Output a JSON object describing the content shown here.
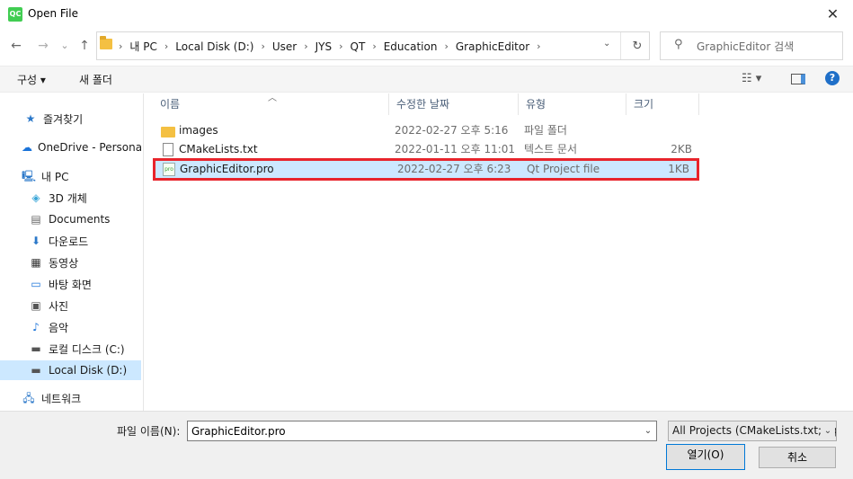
{
  "window": {
    "title": "Open File",
    "app_icon_text": "QC"
  },
  "nav": {
    "back": "←",
    "forward": "→",
    "recent": "⌄",
    "up": "↑",
    "breadcrumbs": [
      "내 PC",
      "Local Disk (D:)",
      "User",
      "JYS",
      "QT",
      "Education",
      "GraphicEditor"
    ],
    "search_placeholder": "GraphicEditor 검색"
  },
  "toolbar": {
    "organize": "구성 ▾",
    "new_folder": "새 폴더"
  },
  "sidebar": {
    "items": [
      {
        "label": "즐겨찾기",
        "icon": "star-icon"
      },
      {
        "label": "OneDrive - Personal",
        "icon": "cloud-icon"
      },
      {
        "label": "내 PC",
        "icon": "pc-icon"
      },
      {
        "label": "3D 개체",
        "icon": "cube-icon"
      },
      {
        "label": "Documents",
        "icon": "document-icon"
      },
      {
        "label": "다운로드",
        "icon": "download-icon"
      },
      {
        "label": "동영상",
        "icon": "video-icon"
      },
      {
        "label": "바탕 화면",
        "icon": "desktop-icon"
      },
      {
        "label": "사진",
        "icon": "picture-icon"
      },
      {
        "label": "음악",
        "icon": "music-icon"
      },
      {
        "label": "로컬 디스크 (C:)",
        "icon": "drive-icon"
      },
      {
        "label": "Local Disk (D:)",
        "icon": "drive-icon"
      },
      {
        "label": "네트워크",
        "icon": "network-icon"
      }
    ],
    "selected_label": "Local Disk (D:)"
  },
  "columns": {
    "name": "이름",
    "date": "수정한 날짜",
    "type": "유형",
    "size": "크기"
  },
  "files": [
    {
      "name": "images",
      "date": "2022-02-27 오후 5:16",
      "type": "파일 폴더",
      "size": "",
      "icon": "folder-icon"
    },
    {
      "name": "CMakeLists.txt",
      "date": "2022-01-11 오후 11:01",
      "type": "텍스트 문서",
      "size": "2KB",
      "icon": "text-file-icon"
    },
    {
      "name": "GraphicEditor.pro",
      "date": "2022-02-27 오후 6:23",
      "type": "Qt Project file",
      "size": "1KB",
      "icon": "pro-file-icon",
      "icon_text": "pro"
    }
  ],
  "bottom": {
    "filename_label": "파일 이름(N):",
    "filename_value": "GraphicEditor.pro",
    "filter_value": "All Projects (CMakeLists.txt;*.q",
    "open_label": "열기(O)",
    "cancel_label": "취소"
  },
  "colors": {
    "selection": "#cce8ff",
    "highlight": "#e8242c",
    "qt_green": "#41cd52"
  }
}
